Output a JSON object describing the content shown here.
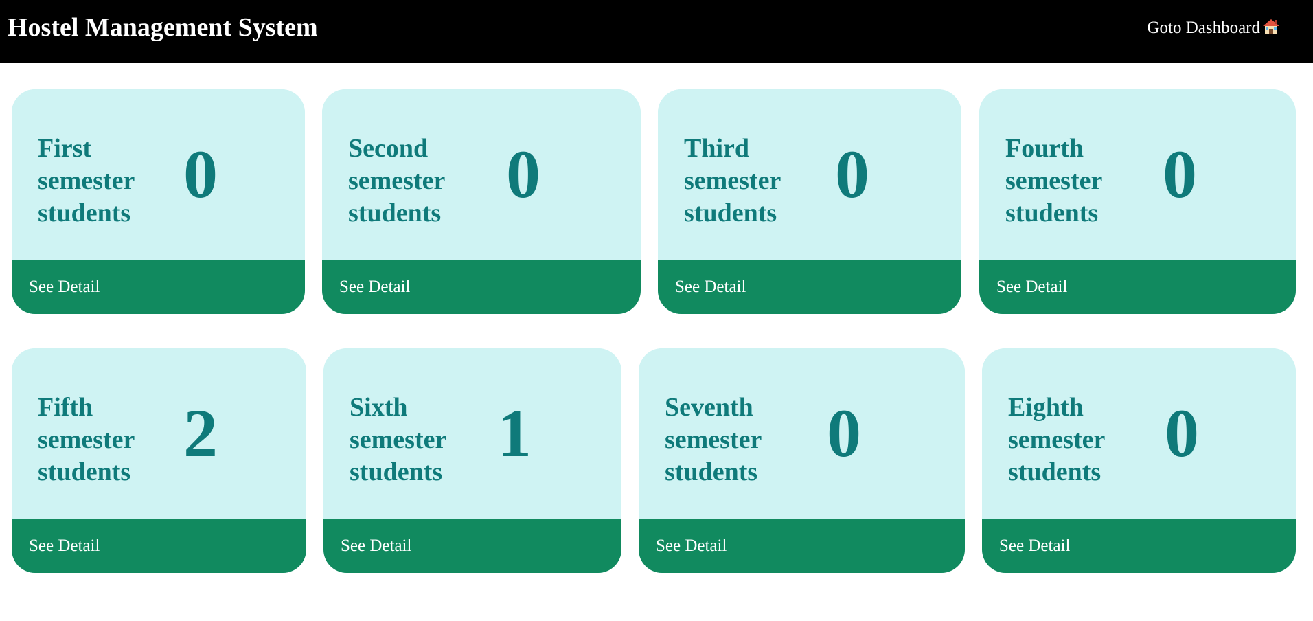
{
  "header": {
    "title": "Hostel Management System",
    "dashboard_link": "Goto Dashboard"
  },
  "cards": [
    {
      "label": "First semester students",
      "count": "0",
      "link": "See Detail"
    },
    {
      "label": "Second semester students",
      "count": "0",
      "link": "See Detail"
    },
    {
      "label": "Third semester students",
      "count": "0",
      "link": "See Detail"
    },
    {
      "label": "Fourth semester students",
      "count": "0",
      "link": "See Detail"
    },
    {
      "label": "Fifth semester students",
      "count": "2",
      "link": "See Detail"
    },
    {
      "label": "Sixth semester students",
      "count": "1",
      "link": "See Detail"
    },
    {
      "label": "Seventh semester students",
      "count": "0",
      "link": "See Detail"
    },
    {
      "label": "Eighth semester students",
      "count": "0",
      "link": "See Detail"
    }
  ],
  "icons": {
    "dashboard": "house-icon"
  },
  "colors": {
    "header_bg": "#000000",
    "card_bg": "#cff3f3",
    "card_text": "#0f7a7a",
    "footer_bg": "#118a5f"
  }
}
